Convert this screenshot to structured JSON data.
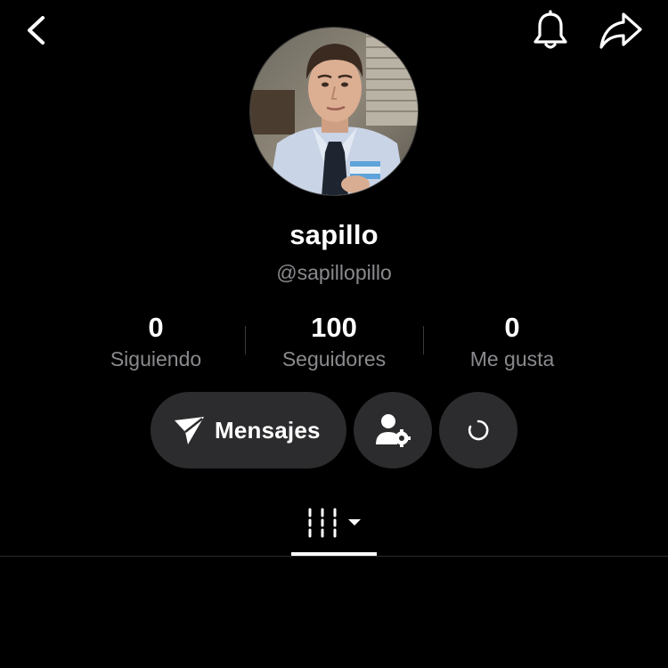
{
  "profile": {
    "display_name": "sapillo",
    "username": "@sapillopillo"
  },
  "stats": [
    {
      "value": "0",
      "label": "Siguiendo"
    },
    {
      "value": "100",
      "label": "Seguidores"
    },
    {
      "value": "0",
      "label": "Me gusta"
    }
  ],
  "actions": {
    "messages_label": "Mensajes"
  },
  "icons": {
    "back": "chevron-left-icon",
    "notifications": "bell-icon",
    "share": "share-arrow-icon",
    "messages": "send-icon",
    "settings": "user-settings-icon",
    "refresh": "loading-icon",
    "grid": "grid-icon",
    "dropdown": "caret-down-icon"
  },
  "colors": {
    "background": "#000000",
    "button": "#2c2c2e",
    "secondary_text": "#8a8a8e",
    "primary_text": "#ffffff"
  }
}
